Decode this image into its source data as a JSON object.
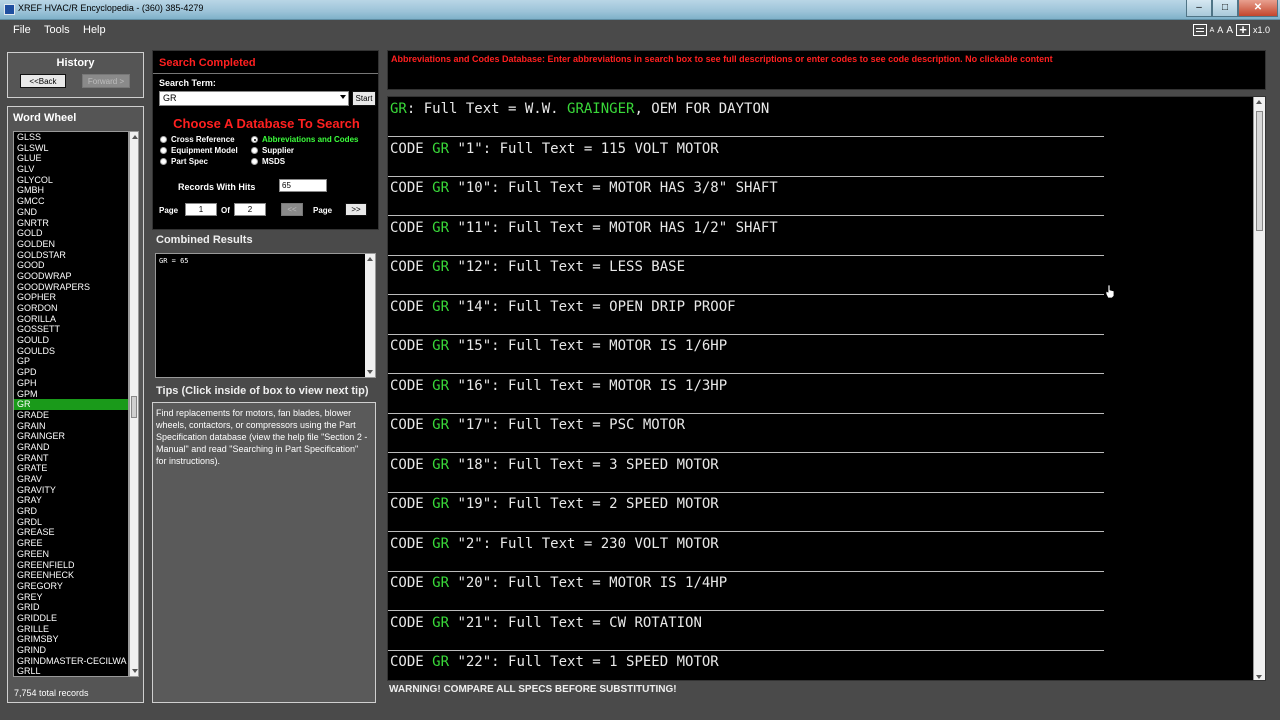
{
  "window": {
    "title": "XREF HVAC/R Encyclopedia - (360) 385-4279",
    "min": "–",
    "max": "□",
    "close": "✕"
  },
  "menu": {
    "file": "File",
    "tools": "Tools",
    "help": "Help",
    "font_sizes": [
      "A",
      "A",
      "A"
    ],
    "zoom": "x1.0"
  },
  "history": {
    "title": "History",
    "back": "<<Back",
    "forward": "Forward >"
  },
  "word_wheel": {
    "title": "Word Wheel",
    "items": [
      "GLSS",
      "GLSWL",
      "GLUE",
      "GLV",
      "GLYCOL",
      "GMBH",
      "GMCC",
      "GND",
      "GNRTR",
      "GOLD",
      "GOLDEN",
      "GOLDSTAR",
      "GOOD",
      "GOODWRAP",
      "GOODWRAPERS",
      "GOPHER",
      "GORDON",
      "GORILLA",
      "GOSSETT",
      "GOULD",
      "GOULDS",
      "GP",
      "GPD",
      "GPH",
      "GPM",
      "GR",
      "GRADE",
      "GRAIN",
      "GRAINGER",
      "GRAND",
      "GRANT",
      "GRATE",
      "GRAV",
      "GRAVITY",
      "GRAY",
      "GRD",
      "GRDL",
      "GREASE",
      "GREE",
      "GREEN",
      "GREENFIELD",
      "GREENHECK",
      "GREGORY",
      "GREY",
      "GRID",
      "GRIDDLE",
      "GRILLE",
      "GRIMSBY",
      "GRIND",
      "GRINDMASTER-CECILWA",
      "GRLL"
    ],
    "selected": "GR",
    "total": "7,754 total records"
  },
  "search": {
    "status": "Search Completed",
    "term_label": "Search Term:",
    "term_value": "GR",
    "start": "Start",
    "choose_title": "Choose A Database To Search",
    "databases": {
      "cross_reference": "Cross Reference",
      "equipment_model": "Equipment Model",
      "part_spec": "Part Spec",
      "abbreviations": "Abbreviations and Codes",
      "supplier": "Supplier",
      "msds": "MSDS"
    },
    "selected_database": "Abbreviations and Codes",
    "records_label": "Records With Hits",
    "records_value": "65",
    "page_label": "Page",
    "page_value": "1",
    "of_label": "Of",
    "of_value": "2",
    "prev": "<<",
    "page_label2": "Page",
    "next": ">>"
  },
  "combined": {
    "title": "Combined Results",
    "text": "GR = 65"
  },
  "tips": {
    "title": "Tips  (Click inside of box to view next tip)",
    "text": "Find replacements for motors, fan blades, blower wheels, contactors, or compressors using the Part Specification database (view the help file \"Section 2 - Manual\" and read \"Searching in Part Specification\" for instructions)."
  },
  "db_banner": "Abbreviations and Codes Database:  Enter abbreviations in search box to see full descriptions or enter codes to see code description.  No clickable content",
  "results": {
    "header": {
      "term": "GR",
      "mid": ": Full Text = W.W. ",
      "highlight": "GRAINGER",
      "tail": ", OEM FOR DAYTON"
    },
    "rows": [
      {
        "prefix": "CODE ",
        "term": "GR",
        "rest": " \"1\": Full Text = 115 VOLT MOTOR"
      },
      {
        "prefix": "CODE ",
        "term": "GR",
        "rest": " \"10\": Full Text = MOTOR HAS 3/8\" SHAFT"
      },
      {
        "prefix": "CODE ",
        "term": "GR",
        "rest": " \"11\": Full Text = MOTOR HAS 1/2\" SHAFT"
      },
      {
        "prefix": "CODE ",
        "term": "GR",
        "rest": " \"12\": Full Text = LESS BASE"
      },
      {
        "prefix": "CODE ",
        "term": "GR",
        "rest": " \"14\": Full Text = OPEN DRIP PROOF"
      },
      {
        "prefix": "CODE ",
        "term": "GR",
        "rest": " \"15\": Full Text = MOTOR IS 1/6HP"
      },
      {
        "prefix": "CODE ",
        "term": "GR",
        "rest": " \"16\": Full Text = MOTOR IS 1/3HP"
      },
      {
        "prefix": "CODE ",
        "term": "GR",
        "rest": " \"17\": Full Text = PSC MOTOR"
      },
      {
        "prefix": "CODE ",
        "term": "GR",
        "rest": " \"18\": Full Text = 3 SPEED MOTOR"
      },
      {
        "prefix": "CODE ",
        "term": "GR",
        "rest": " \"19\": Full Text = 2 SPEED MOTOR"
      },
      {
        "prefix": "CODE ",
        "term": "GR",
        "rest": " \"2\": Full Text = 230 VOLT MOTOR"
      },
      {
        "prefix": "CODE ",
        "term": "GR",
        "rest": " \"20\": Full Text = MOTOR IS 1/4HP"
      },
      {
        "prefix": "CODE ",
        "term": "GR",
        "rest": " \"21\": Full Text = CW ROTATION"
      },
      {
        "prefix": "CODE ",
        "term": "GR",
        "rest": " \"22\": Full Text = 1 SPEED MOTOR"
      }
    ]
  },
  "warning": "WARNING!  COMPARE ALL SPECS BEFORE SUBSTITUTING!"
}
